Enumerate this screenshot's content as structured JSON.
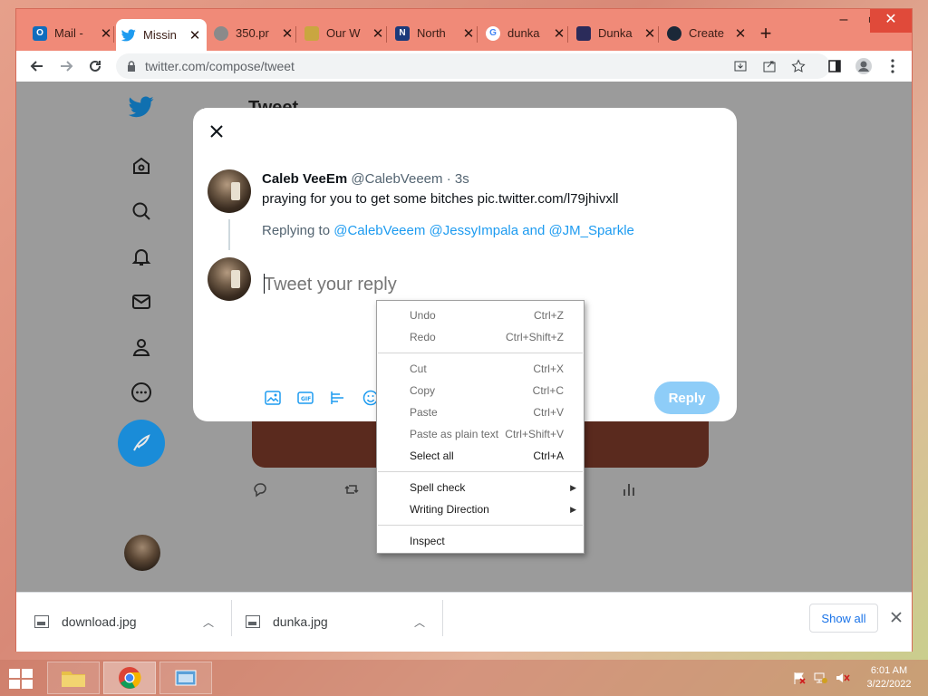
{
  "tabs": [
    {
      "title": "Mail -",
      "icon": "outlook-icon",
      "color": "#0f6cbd",
      "glyph": "O"
    },
    {
      "title": "Missin",
      "icon": "twitter-icon",
      "color": "#1d9bf0",
      "glyph": ""
    },
    {
      "title": "350.pr",
      "icon": "globe-icon",
      "color": "#7a7a7a",
      "glyph": ""
    },
    {
      "title": "Our W",
      "icon": "site-icon",
      "color": "#c9a640",
      "glyph": ""
    },
    {
      "title": "North",
      "icon": "n-logo-icon",
      "color": "#1b3a7a",
      "glyph": "N"
    },
    {
      "title": "dunka",
      "icon": "google-icon",
      "color": "#4285f4",
      "glyph": "G"
    },
    {
      "title": "Dunka",
      "icon": "meme-site-icon",
      "color": "#2b2b5a",
      "glyph": ""
    },
    {
      "title": "Create",
      "icon": "steam-icon",
      "color": "#1b2838",
      "glyph": ""
    }
  ],
  "address": {
    "url": "twitter.com/compose/tweet"
  },
  "background": {
    "heading": "Tweet"
  },
  "modal": {
    "author_name": "Caleb VeeEm",
    "author_handle": "@CalebVeeem",
    "time": "· 3s",
    "tweet_text": "praying for you to get some bitches pic.twitter.com/l79jhivxll",
    "replying_prefix": "Replying to",
    "replying_to": "@CalebVeeem @JessyImpala and @JM_Sparkle",
    "placeholder": "Tweet your reply",
    "reply_button": "Reply"
  },
  "context_menu": {
    "items": [
      {
        "label": "Undo",
        "shortcut": "Ctrl+Z"
      },
      {
        "label": "Redo",
        "shortcut": "Ctrl+Shift+Z"
      },
      {
        "label": "Cut",
        "shortcut": "Ctrl+X"
      },
      {
        "label": "Copy",
        "shortcut": "Ctrl+C"
      },
      {
        "label": "Paste",
        "shortcut": "Ctrl+V"
      },
      {
        "label": "Paste as plain text",
        "shortcut": "Ctrl+Shift+V"
      },
      {
        "label": "Select all",
        "shortcut": "Ctrl+A"
      },
      {
        "label": "Spell check",
        "shortcut": ""
      },
      {
        "label": "Writing Direction",
        "shortcut": ""
      },
      {
        "label": "Inspect",
        "shortcut": ""
      }
    ]
  },
  "downloads": {
    "files": [
      {
        "name": "download.jpg"
      },
      {
        "name": "dunka.jpg"
      }
    ],
    "show_all": "Show all"
  },
  "taskbar": {
    "time": "6:01 AM",
    "date": "3/22/2022"
  },
  "colors": {
    "twitter_blue": "#1d9bf0",
    "reply_disabled": "#8ecdf8",
    "chrome_frame": "#f08a78"
  }
}
